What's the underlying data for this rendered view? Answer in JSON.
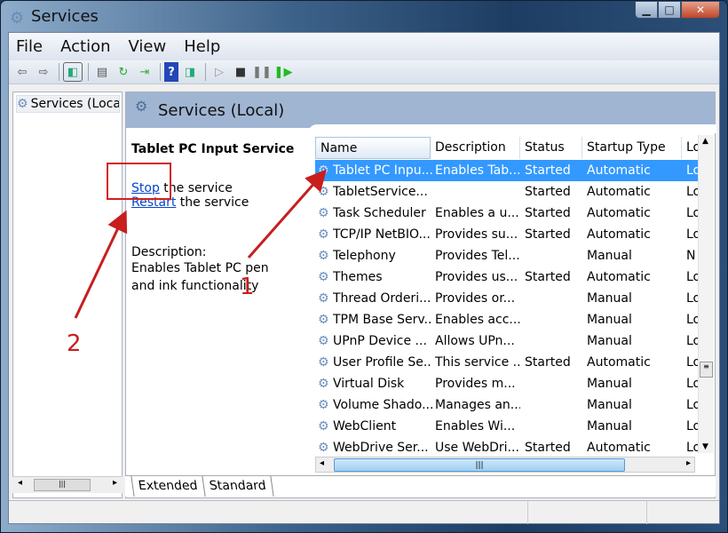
{
  "window": {
    "title": "Services",
    "buttons": [
      "minimize",
      "maximize",
      "close"
    ]
  },
  "menu": [
    "File",
    "Action",
    "View",
    "Help"
  ],
  "toolbar": [
    "back-icon",
    "forward-icon",
    "show-hide-tree-icon",
    "properties-icon",
    "refresh-icon",
    "export-icon",
    "help-icon",
    "show-action-pane-icon",
    "start-icon",
    "stop-icon",
    "pause-icon",
    "restart-icon"
  ],
  "tree": {
    "item": "Services (Local)"
  },
  "panel": {
    "title": "Services (Local)"
  },
  "detail": {
    "service_name": "Tablet PC Input Service",
    "stop_link": "Stop",
    "stop_suffix": " the service",
    "restart_link": "Restart",
    "restart_suffix": " the service",
    "description_label": "Description:",
    "description": "Enables Tablet PC pen and ink functionality"
  },
  "columns": [
    "Name",
    "Description",
    "Status",
    "Startup Type",
    "Lo"
  ],
  "rows": [
    {
      "name": "Tablet PC Inpu...",
      "desc": "Enables Tab...",
      "status": "Started",
      "startup": "Automatic",
      "logon": "Lo",
      "selected": true
    },
    {
      "name": "TabletService...",
      "desc": "",
      "status": "Started",
      "startup": "Automatic",
      "logon": "Lo"
    },
    {
      "name": "Task Scheduler",
      "desc": "Enables a u...",
      "status": "Started",
      "startup": "Automatic",
      "logon": "Lo"
    },
    {
      "name": "TCP/IP NetBIO...",
      "desc": "Provides su...",
      "status": "Started",
      "startup": "Automatic",
      "logon": "Lo"
    },
    {
      "name": "Telephony",
      "desc": "Provides Tel...",
      "status": "",
      "startup": "Manual",
      "logon": "N"
    },
    {
      "name": "Themes",
      "desc": "Provides us...",
      "status": "Started",
      "startup": "Automatic",
      "logon": "Lo"
    },
    {
      "name": "Thread Orderi...",
      "desc": "Provides or...",
      "status": "",
      "startup": "Manual",
      "logon": "Lo"
    },
    {
      "name": "TPM Base Serv...",
      "desc": "Enables acc...",
      "status": "",
      "startup": "Manual",
      "logon": "Lo"
    },
    {
      "name": "UPnP Device ...",
      "desc": "Allows UPn...",
      "status": "",
      "startup": "Manual",
      "logon": "Lo"
    },
    {
      "name": "User Profile Se...",
      "desc": "This service ...",
      "status": "Started",
      "startup": "Automatic",
      "logon": "Lo"
    },
    {
      "name": "Virtual Disk",
      "desc": "Provides m...",
      "status": "",
      "startup": "Manual",
      "logon": "Lo"
    },
    {
      "name": "Volume Shado...",
      "desc": "Manages an...",
      "status": "",
      "startup": "Manual",
      "logon": "Lo"
    },
    {
      "name": "WebClient",
      "desc": "Enables Wi...",
      "status": "",
      "startup": "Manual",
      "logon": "Lo"
    },
    {
      "name": "WebDrive Ser...",
      "desc": "Use WebDri...",
      "status": "Started",
      "startup": "Automatic",
      "logon": "Lo"
    }
  ],
  "tabs": [
    "Extended",
    "Standard"
  ],
  "annotations": {
    "one": "1",
    "two": "2",
    "color": "#c81e1e"
  }
}
